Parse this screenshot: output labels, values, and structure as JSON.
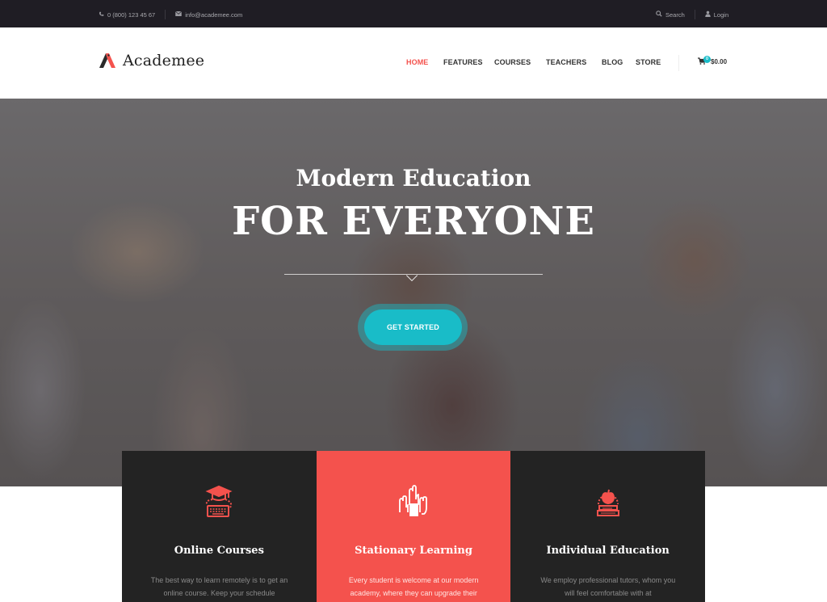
{
  "topbar": {
    "phone": "0 (800) 123 45 67",
    "email": "info@academee.com",
    "search_label": "Search",
    "login_label": "Login",
    "icons": {
      "phone": "phone-icon",
      "email": "envelope-icon",
      "search": "search-icon",
      "login": "user-icon"
    }
  },
  "header": {
    "logo_text": "Academee",
    "nav": [
      {
        "label": "HOME",
        "active": true
      },
      {
        "label": "FEATURES",
        "active": false
      },
      {
        "label": "COURSES",
        "active": false
      },
      {
        "label": "TEACHERS",
        "active": false
      },
      {
        "label": "BLOG",
        "active": false
      },
      {
        "label": "STORE",
        "active": false
      }
    ],
    "cart": {
      "count": "0",
      "total": "$0.00"
    }
  },
  "hero": {
    "subtitle": "Modern Education",
    "title": "FOR EVERYONE",
    "cta_label": "GET STARTED"
  },
  "features": [
    {
      "title": "Online Courses",
      "text": "The best way to learn remotely is to get an online course. Keep your schedule",
      "icon": "graduation-cap-keyboard-icon",
      "style": "dark"
    },
    {
      "title": "Stationary Learning",
      "text": "Every student is welcome at our modern academy, where they can upgrade their",
      "icon": "raised-hands-icon",
      "style": "accent"
    },
    {
      "title": "Individual Education",
      "text": "We employ professional tutors, whom you will feel comfortable with at",
      "icon": "apple-books-icon",
      "style": "dark"
    }
  ],
  "colors": {
    "accent": "#f4524d",
    "cta": "#19bcc8",
    "topbar": "#1f1d24",
    "feature_dark": "#232323"
  }
}
